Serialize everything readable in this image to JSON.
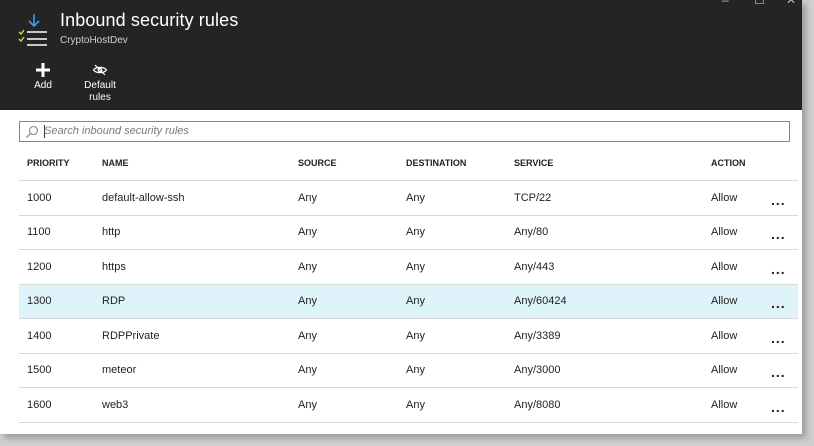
{
  "header": {
    "title": "Inbound security rules",
    "subtitle": "CryptoHostDev",
    "icon": "inbound-rules-icon"
  },
  "window_controls": {
    "minimize": "–",
    "maximize": "☐",
    "close": "✕"
  },
  "commands": {
    "add_label": "Add",
    "default_rules_line1": "Default",
    "default_rules_line2": "rules"
  },
  "search": {
    "placeholder": "Search inbound security rules",
    "value": ""
  },
  "table": {
    "columns": {
      "priority": "PRIORITY",
      "name": "NAME",
      "source": "SOURCE",
      "destination": "DESTINATION",
      "service": "SERVICE",
      "action": "ACTION"
    },
    "rows": [
      {
        "priority": "1000",
        "name": "default-allow-ssh",
        "source": "Any",
        "destination": "Any",
        "service": "TCP/22",
        "action": "Allow"
      },
      {
        "priority": "1100",
        "name": "http",
        "source": "Any",
        "destination": "Any",
        "service": "Any/80",
        "action": "Allow"
      },
      {
        "priority": "1200",
        "name": "https",
        "source": "Any",
        "destination": "Any",
        "service": "Any/443",
        "action": "Allow"
      },
      {
        "priority": "1300",
        "name": "RDP",
        "source": "Any",
        "destination": "Any",
        "service": "Any/60424",
        "action": "Allow"
      },
      {
        "priority": "1400",
        "name": "RDPPrivate",
        "source": "Any",
        "destination": "Any",
        "service": "Any/3389",
        "action": "Allow"
      },
      {
        "priority": "1500",
        "name": "meteor",
        "source": "Any",
        "destination": "Any",
        "service": "Any/3000",
        "action": "Allow"
      },
      {
        "priority": "1600",
        "name": "web3",
        "source": "Any",
        "destination": "Any",
        "service": "Any/8080",
        "action": "Allow"
      }
    ],
    "more_label": "..."
  },
  "colors": {
    "header_bg": "#242424",
    "allow": "#33aa33",
    "selected_row": "#dff4fa",
    "search_border": "#3aa0c8"
  }
}
